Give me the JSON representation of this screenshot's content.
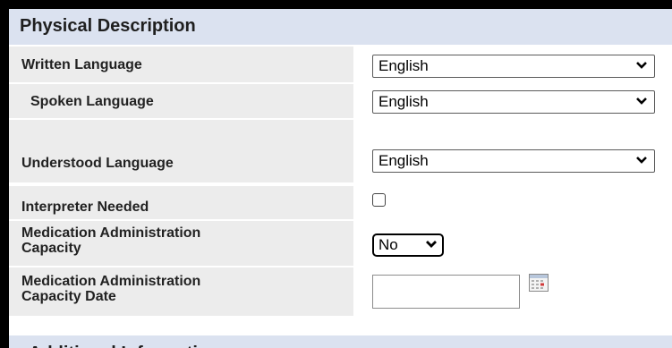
{
  "section": {
    "title": "Physical Description"
  },
  "fields": {
    "written_language": {
      "label": "Written Language",
      "value": "English"
    },
    "spoken_language": {
      "label": "Spoken Language",
      "value": "English"
    },
    "understood_language": {
      "label": "Understood Language",
      "value": "English"
    },
    "interpreter_needed": {
      "label": "Interpreter Needed",
      "checked": false
    },
    "med_admin_capacity": {
      "label_line1": "Medication Administration",
      "label_line2": "Capacity",
      "value": "No"
    },
    "med_admin_capacity_date": {
      "label_line1": "Medication Administration",
      "label_line2": "Capacity Date",
      "value": ""
    }
  },
  "next_section": {
    "title": "Additional Information"
  },
  "icons": {
    "dropdown": "chevron-down-icon",
    "calendar": "calendar-icon"
  },
  "colors": {
    "header_bg": "#dbe2f0",
    "label_bg": "#ececec",
    "page_border": "#000000"
  }
}
